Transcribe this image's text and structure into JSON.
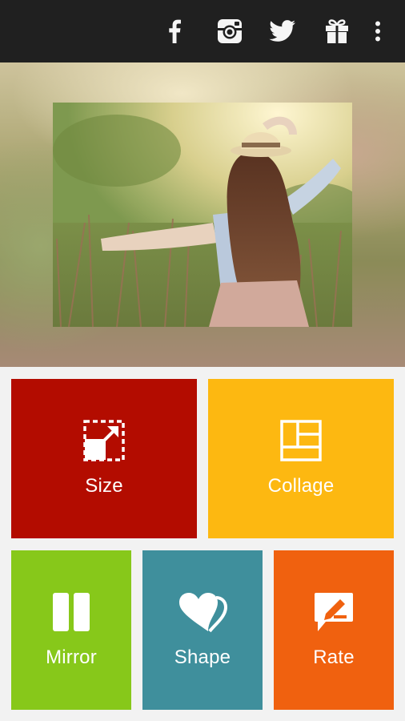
{
  "topbar": {
    "icons": [
      "facebook-icon",
      "instagram-icon",
      "twitter-icon",
      "gift-icon",
      "more-vert-icon"
    ]
  },
  "hero": {
    "photo_description_icon": "photo"
  },
  "tiles": [
    {
      "label": "Size",
      "icon": "resize-icon",
      "color": "#b30c00"
    },
    {
      "label": "Collage",
      "icon": "collage-grid-icon",
      "color": "#fdb811"
    },
    {
      "label": "Mirror",
      "icon": "mirror-icon",
      "color": "#87c81a"
    },
    {
      "label": "Shape",
      "icon": "hearts-icon",
      "color": "#3f8f9c"
    },
    {
      "label": "Rate",
      "icon": "rate-edit-icon",
      "color": "#f0610f"
    }
  ],
  "colors": {
    "topbar": "#202020",
    "background": "#f2f2f2",
    "icon": "#ffffff"
  }
}
